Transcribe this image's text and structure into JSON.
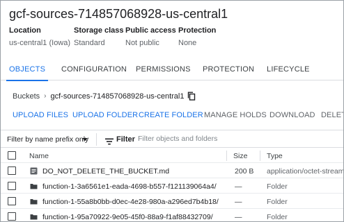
{
  "bucket": {
    "title": "gcf-sources-714857068928-us-central1"
  },
  "meta": [
    {
      "label": "Location",
      "value": "us-central1 (Iowa)"
    },
    {
      "label": "Storage class",
      "value": "Standard"
    },
    {
      "label": "Public access",
      "value": "Not public"
    },
    {
      "label": "Protection",
      "value": "None"
    }
  ],
  "tabs": [
    {
      "label": "OBJECTS",
      "active": true
    },
    {
      "label": "CONFIGURATION",
      "active": false
    },
    {
      "label": "PERMISSIONS",
      "active": false
    },
    {
      "label": "PROTECTION",
      "active": false
    },
    {
      "label": "LIFECYCLE",
      "active": false
    }
  ],
  "breadcrumb": {
    "root": "Buckets",
    "separator": "›",
    "current": "gcf-sources-714857068928-us-central1"
  },
  "actions": [
    {
      "label": "UPLOAD FILES",
      "enabled": true
    },
    {
      "label": "UPLOAD FOLDER",
      "enabled": true
    },
    {
      "label": "CREATE FOLDER",
      "enabled": true
    },
    {
      "label": "MANAGE HOLDS",
      "enabled": false
    },
    {
      "label": "DOWNLOAD",
      "enabled": false
    },
    {
      "label": "DELETE",
      "enabled": false
    }
  ],
  "filter": {
    "select_label": "Filter by name prefix only",
    "filter_label": "Filter",
    "placeholder": "Filter objects and folders"
  },
  "table": {
    "headers": {
      "name": "Name",
      "size": "Size",
      "type": "Type"
    },
    "rows": [
      {
        "icon": "file-icon",
        "name": "DO_NOT_DELETE_THE_BUCKET.md",
        "size": "200 B",
        "type": "application/octet-stream"
      },
      {
        "icon": "folder-icon",
        "name": "function-1-3a6561e1-eada-4698-b557-f121139064a4/",
        "size": "—",
        "type": "Folder"
      },
      {
        "icon": "folder-icon",
        "name": "function-1-55a8b0bb-d0ec-4e28-980a-a296ed7b4b18/",
        "size": "—",
        "type": "Folder"
      },
      {
        "icon": "folder-icon",
        "name": "function-1-95a70922-9e05-45f0-88a9-f1af88432709/",
        "size": "—",
        "type": "Folder"
      }
    ]
  },
  "colors": {
    "accent": "#1a73e8",
    "disabled": "#5f6368",
    "text": "#202124"
  }
}
